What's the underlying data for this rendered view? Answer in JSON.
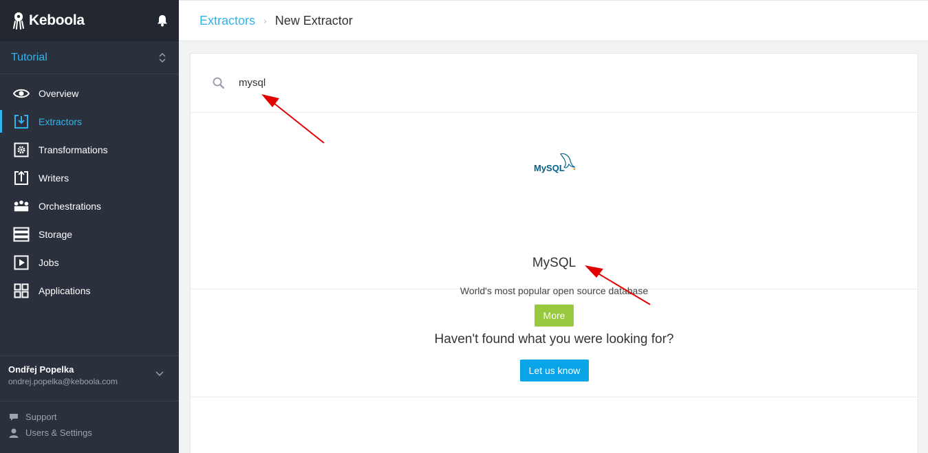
{
  "app": {
    "brand": "Keboola",
    "project": "Tutorial"
  },
  "sidebar": {
    "items": [
      {
        "label": "Overview",
        "icon": "eye-icon",
        "active": false
      },
      {
        "label": "Extractors",
        "icon": "download-box-icon",
        "active": true
      },
      {
        "label": "Transformations",
        "icon": "gear-box-icon",
        "active": false
      },
      {
        "label": "Writers",
        "icon": "upload-box-icon",
        "active": false
      },
      {
        "label": "Orchestrations",
        "icon": "orchestration-icon",
        "active": false
      },
      {
        "label": "Storage",
        "icon": "storage-icon",
        "active": false
      },
      {
        "label": "Jobs",
        "icon": "play-box-icon",
        "active": false
      },
      {
        "label": "Applications",
        "icon": "grid-icon",
        "active": false
      }
    ],
    "user": {
      "name": "Ondřej Popelka",
      "email": "ondrej.popelka@keboola.com"
    },
    "footer": {
      "support": "Support",
      "settings": "Users & Settings"
    }
  },
  "header": {
    "breadcrumb_link": "Extractors",
    "breadcrumb_current": "New Extractor"
  },
  "search": {
    "value": "mysql"
  },
  "result": {
    "name": "MySQL",
    "description": "World's most popular open source database",
    "more_label": "More",
    "logo_text": "MySQL"
  },
  "notfound": {
    "title": "Haven't found what you were looking for?",
    "button_label": "Let us know"
  },
  "colors": {
    "accent": "#2fb5ee",
    "sidebar": "#2b313c",
    "more_button": "#96c93d",
    "let_button": "#0aa4e8",
    "annotation_arrow": "#e00000"
  }
}
